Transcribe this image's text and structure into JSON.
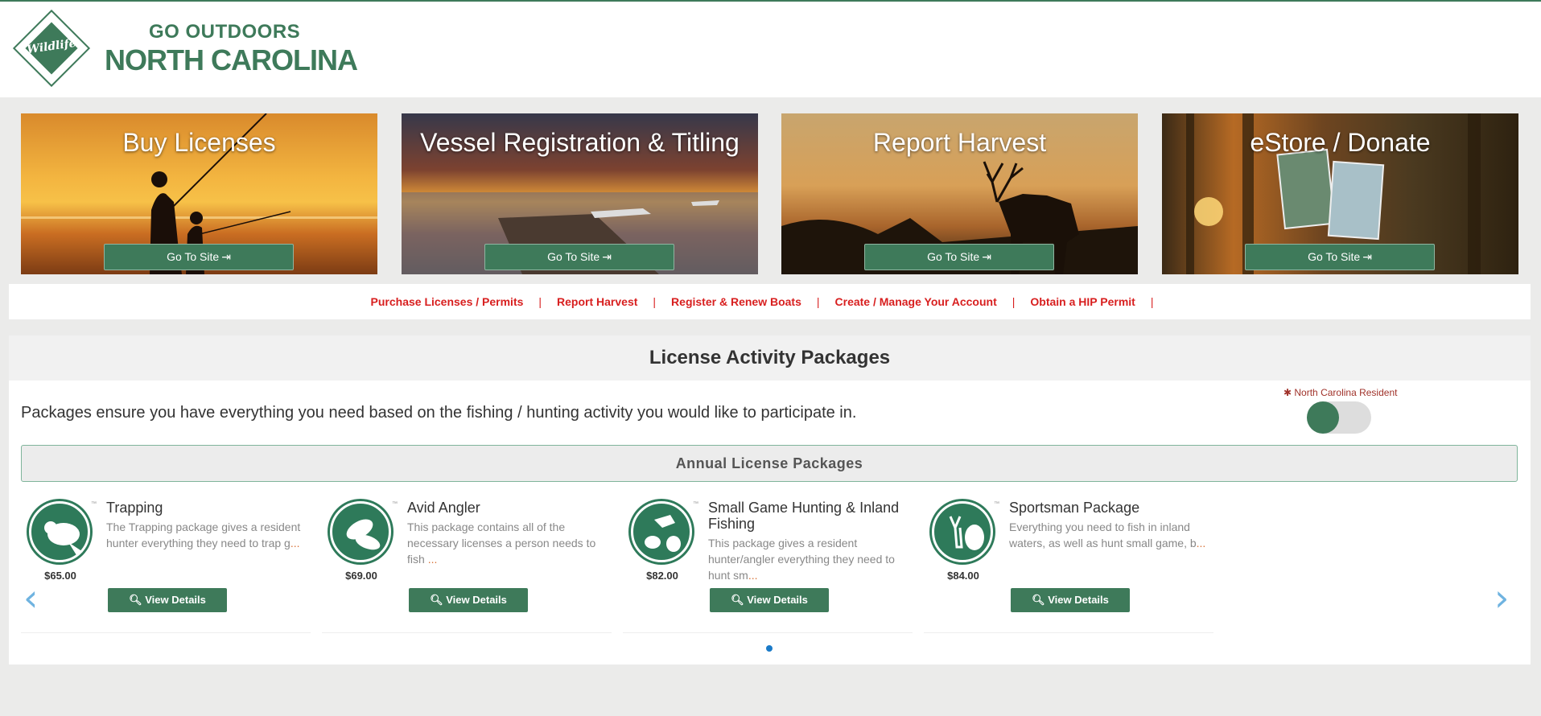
{
  "header": {
    "logo_text": "Wildlife",
    "brand_top": "GO OUTDOORS",
    "brand_main": "NORTH CAROLINA"
  },
  "tiles": [
    {
      "title": "Buy Licenses",
      "button": "Go To Site"
    },
    {
      "title": "Vessel Registration & Titling",
      "button": "Go To Site"
    },
    {
      "title": "Report Harvest",
      "button": "Go To Site"
    },
    {
      "title": "eStore / Donate",
      "button": "Go To Site"
    }
  ],
  "links": [
    "Purchase Licenses / Permits",
    "Report Harvest",
    "Register & Renew Boats",
    "Create / Manage Your Account",
    "Obtain a HIP Permit"
  ],
  "link_separator": "|",
  "packages": {
    "heading": "License Activity Packages",
    "intro": "Packages ensure you have everything you need based on the fishing / hunting activity you would like to participate in.",
    "resident_label": "✱ North Carolina Resident",
    "section_label": "Annual License Packages",
    "tm": "™",
    "items": [
      {
        "name": "Trapping",
        "desc": "The Trapping package gives a resident hunter everything they need to trap g",
        "more": "...",
        "price": "$65.00",
        "button": "View Details",
        "icon": "beaver-icon"
      },
      {
        "name": "Avid Angler",
        "desc": "This package contains all of the necessary licenses a person needs to fish ",
        "more": "...",
        "price": "$69.00",
        "button": "View Details",
        "icon": "fish-icon"
      },
      {
        "name": "Small Game Hunting & Inland Fishing",
        "desc": "This package gives a resident hunter/angler everything they need to hunt sm",
        "more": "...",
        "price": "$82.00",
        "button": "View Details",
        "icon": "small-game-icon"
      },
      {
        "name": "Sportsman Package",
        "desc": "Everything you need to fish in inland waters, as well as hunt small game, b",
        "more": "...",
        "price": "$84.00",
        "button": "View Details",
        "icon": "sportsman-icon"
      }
    ]
  },
  "colors": {
    "brand_green": "#3e7a5a",
    "link_red": "#d81f1f",
    "arrow_blue": "#6fb3e0"
  }
}
